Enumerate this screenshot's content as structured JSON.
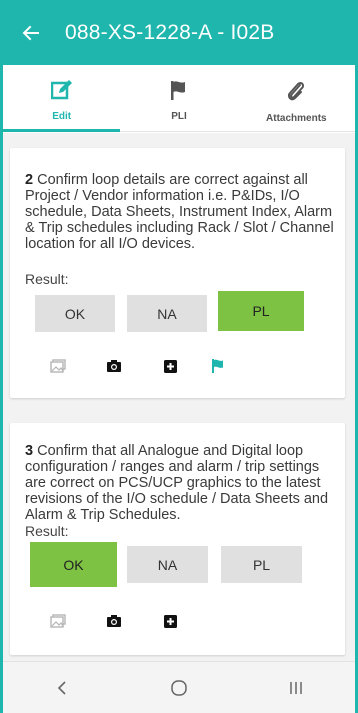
{
  "header": {
    "title": "088-XS-1228-A - I02B"
  },
  "tabs": [
    {
      "label": "Edit",
      "icon": "edit-icon",
      "active": true
    },
    {
      "label": "PLI",
      "icon": "flag-icon",
      "active": false
    },
    {
      "label": "Attachments",
      "icon": "paperclip-icon",
      "active": false
    }
  ],
  "items": [
    {
      "number": "2",
      "text": " Confirm loop details are correct against all Project / Vendor information i.e. P&IDs, I/O schedule, Data Sheets, Instrument Index, Alarm & Trip schedules including Rack / Slot / Channel location for all I/O devices.",
      "result_label": "Result:",
      "options": [
        "OK",
        "NA",
        "PL"
      ],
      "selected": "PL"
    },
    {
      "number": "3",
      "text": " Confirm that all Analogue and Digital loop configuration / ranges and alarm / trip settings are correct on PCS/UCP graphics to the latest revisions of the I/O schedule / Data Sheets and Alarm & Trip Schedules.",
      "result_label": "Result:",
      "options": [
        "OK",
        "NA",
        "PL"
      ],
      "selected": "OK"
    }
  ],
  "colors": {
    "primary": "#1fb6ad",
    "selected": "#7ec243",
    "unselected": "#e0e0e0"
  }
}
